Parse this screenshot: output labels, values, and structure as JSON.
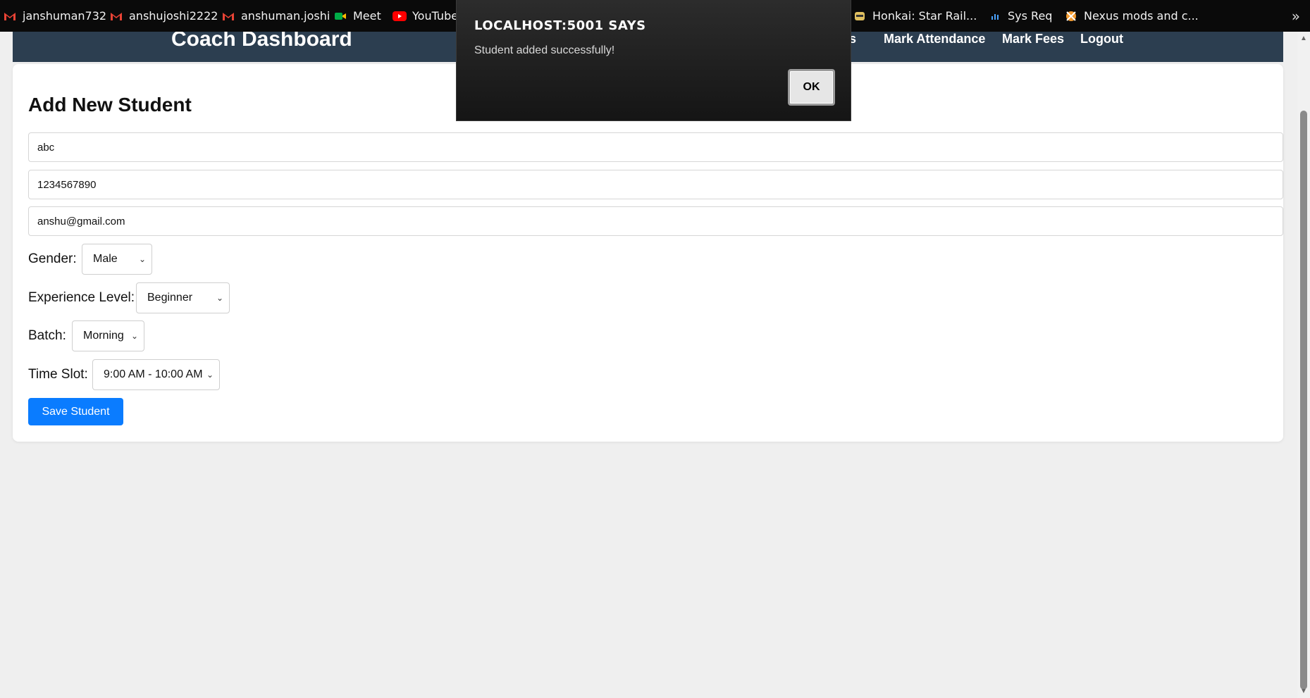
{
  "bookmarks": [
    {
      "label": "janshuman732",
      "icon": "gmail-icon",
      "color": "#ea4335"
    },
    {
      "label": "anshujoshi2222",
      "icon": "gmail-icon",
      "color": "#ea4335"
    },
    {
      "label": "anshuman.joshi",
      "icon": "gmail-icon",
      "color": "#ea4335"
    },
    {
      "label": "Meet",
      "icon": "google-meet-icon",
      "color": "#00ac47"
    },
    {
      "label": "YouTube",
      "icon": "youtube-icon",
      "color": "#ff0000"
    },
    {
      "label": "Honkai: Star Rail...",
      "icon": "honkai-icon",
      "color": "#e0c060"
    },
    {
      "label": "Sys Req",
      "icon": "sysreq-icon",
      "color": "#4aa3ff"
    },
    {
      "label": "Nexus mods and c...",
      "icon": "nexus-icon",
      "color": "#f29b30"
    }
  ],
  "header": {
    "title": "Coach Dashboard",
    "nav": [
      "nts",
      "Mark Attendance",
      "Mark Fees",
      "Logout"
    ]
  },
  "form": {
    "heading": "Add New Student",
    "name_value": "abc",
    "phone_value": "1234567890",
    "email_value": "anshu@gmail.com",
    "gender_label": "Gender:",
    "gender_value": "Male",
    "experience_label": "Experience Level:",
    "experience_value": "Beginner",
    "batch_label": "Batch:",
    "batch_value": "Morning",
    "timeslot_label": "Time Slot:",
    "timeslot_value": "9:00 AM - 10:00 AM",
    "save_label": "Save Student"
  },
  "dialog": {
    "title": "LOCALHOST:5001 SAYS",
    "message": "Student added successfully!",
    "ok_label": "OK"
  },
  "colors": {
    "header_bg": "#2c3e50",
    "primary_button": "#0a7cff",
    "page_bg": "#efefef"
  }
}
